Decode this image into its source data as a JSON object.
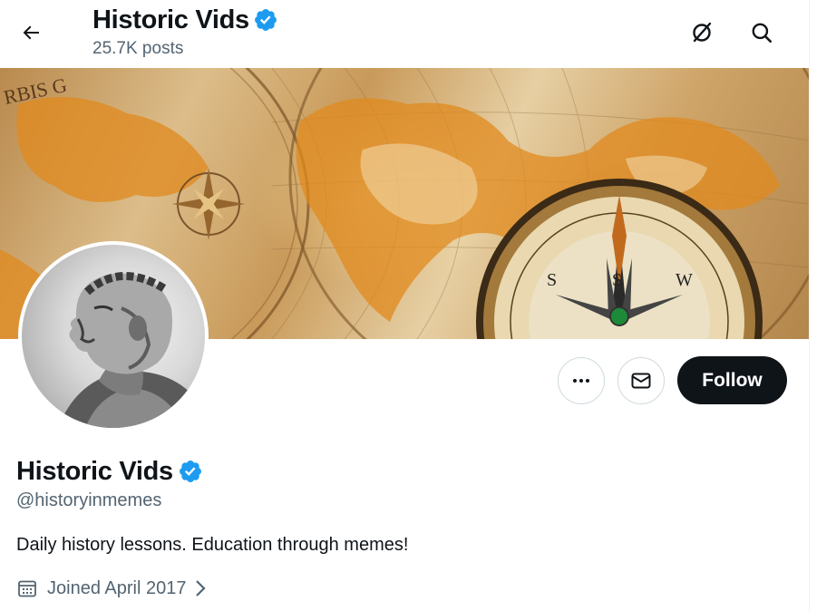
{
  "header": {
    "title": "Historic Vids",
    "posts_count": "25.7K posts"
  },
  "profile": {
    "display_name": "Historic Vids",
    "handle": "@historyinmemes",
    "bio": "Daily history lessons. Education through memes!",
    "joined": "Joined April 2017"
  },
  "actions": {
    "follow_label": "Follow"
  },
  "icons": {
    "back": "arrow-left-icon",
    "grok": "grok-icon",
    "search": "search-icon",
    "verified": "verified-badge-icon",
    "more": "more-dots-icon",
    "message": "envelope-icon",
    "calendar": "calendar-icon",
    "chevron": "chevron-right-icon"
  },
  "colors": {
    "verified": "#1d9bf0",
    "follow_bg": "#0f1419",
    "secondary_text": "#536471"
  }
}
